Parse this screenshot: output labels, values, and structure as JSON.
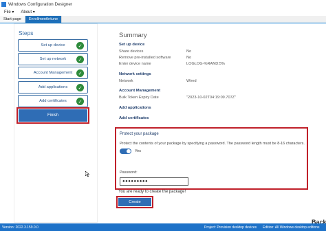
{
  "window": {
    "title": "Windows Configuration Designer"
  },
  "menu": [
    {
      "label": "File ▾"
    },
    {
      "label": "About ▾"
    }
  ],
  "tabs": [
    {
      "label": "Start page"
    },
    {
      "label": "EnrollmentIntune"
    }
  ],
  "steps": {
    "header": "Steps",
    "items": [
      {
        "label": "Set up device"
      },
      {
        "label": "Set up network"
      },
      {
        "label": "Account Management"
      },
      {
        "label": "Add applications"
      },
      {
        "label": "Add certificates"
      }
    ],
    "finish_label": "Finish"
  },
  "summary": {
    "title": "Summary",
    "setup_device": {
      "header": "Set up device",
      "rows": [
        {
          "label": "Share devices",
          "value": "No"
        },
        {
          "label": "Remove pre-installed software",
          "value": "No"
        },
        {
          "label": "Enter device name",
          "value": "LOGLOG-%RAND:5%"
        }
      ]
    },
    "network": {
      "header": "Network settings",
      "rows": [
        {
          "label": "Network",
          "value": "Wired"
        }
      ]
    },
    "account": {
      "header": "Account Management",
      "rows": [
        {
          "label": "Bulk Token Expiry Date",
          "value": "\"2023-10-02T04:19:09.707Z\""
        }
      ]
    },
    "apps_header": "Add applications",
    "certs_header": "Add certificates"
  },
  "protect": {
    "title": "Protect your package",
    "description": "Protect the contents of your package by specifying a password. The password length must be 8-16 characters.",
    "toggle_label": "Yes",
    "toggle_on": true,
    "password_label": "Password:",
    "password_value": "●●●●●●●●●"
  },
  "ready_text": "You are ready to create the package!",
  "create_label": "Create",
  "back_label": "Back",
  "status": {
    "version": "Version: 2022.3.159.0.0",
    "project": "Project: Provision desktop devices",
    "edition": "Edition: All Windows desktop editions"
  },
  "colors": {
    "accent": "#2f6db5",
    "highlight": "#c0202a",
    "check": "#2e8b3c"
  }
}
